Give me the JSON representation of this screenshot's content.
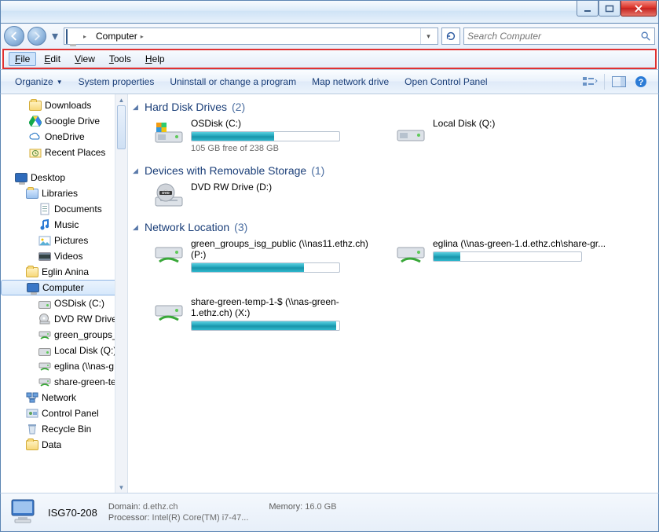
{
  "titlebar": {},
  "nav": {
    "breadcrumb_root_icon": "computer-icon",
    "breadcrumb_1": "Computer",
    "search_placeholder": "Search Computer"
  },
  "menubar": {
    "file": "File",
    "file_u": "F",
    "edit": "Edit",
    "edit_u": "E",
    "view": "View",
    "view_u": "V",
    "tools": "Tools",
    "tools_u": "T",
    "help": "Help",
    "help_u": "H"
  },
  "cmdbar": {
    "organize": "Organize",
    "sysprops": "System properties",
    "uninstall": "Uninstall or change a program",
    "mapdrive": "Map network drive",
    "controlpanel": "Open Control Panel"
  },
  "tree": {
    "quick": [
      {
        "name": "Downloads",
        "icon": "folder"
      },
      {
        "name": "Google Drive",
        "icon": "gdrive"
      },
      {
        "name": "OneDrive",
        "icon": "onedrive"
      },
      {
        "name": "Recent Places",
        "icon": "recent"
      }
    ],
    "desktop": "Desktop",
    "libraries": "Libraries",
    "lib_items": [
      {
        "name": "Documents",
        "icon": "doc"
      },
      {
        "name": "Music",
        "icon": "music"
      },
      {
        "name": "Pictures",
        "icon": "pic"
      },
      {
        "name": "Videos",
        "icon": "vid"
      }
    ],
    "user": "Eglin  Anina",
    "computer": "Computer",
    "drives": [
      {
        "name": "OSDisk (C:)",
        "icon": "osdrive"
      },
      {
        "name": "DVD RW Drive (",
        "icon": "dvd"
      },
      {
        "name": "green_groups_i",
        "icon": "netdrive"
      },
      {
        "name": "Local Disk (Q:)",
        "icon": "drive"
      },
      {
        "name": "eglina (\\\\nas-g",
        "icon": "netdrive"
      },
      {
        "name": "share-green-te",
        "icon": "netdrive"
      }
    ],
    "network": "Network",
    "cpanel": "Control Panel",
    "recycle": "Recycle Bin",
    "data": "Data"
  },
  "sections": {
    "hdd": {
      "title": "Hard Disk Drives",
      "count": "(2)"
    },
    "removable": {
      "title": "Devices with Removable Storage",
      "count": "(1)"
    },
    "netloc": {
      "title": "Network Location",
      "count": "(3)"
    }
  },
  "drives": {
    "osdisk": {
      "name": "OSDisk (C:)",
      "free": "105 GB free of 238 GB",
      "fill_pct": 56
    },
    "localq": {
      "name": "Local Disk (Q:)"
    },
    "dvd": {
      "name": "DVD RW Drive (D:)"
    },
    "p": {
      "name": "green_groups_isg_public (\\\\nas11.ethz.ch) (P:)",
      "fill_pct": 76
    },
    "eglina": {
      "name": "eglina (\\\\nas-green-1.d.ethz.ch\\share-gr...",
      "fill_pct": 18
    },
    "x": {
      "name": "share-green-temp-1-$ (\\\\nas-green-1.ethz.ch) (X:)",
      "fill_pct": 98
    }
  },
  "details": {
    "name": "ISG70-208",
    "domain_label": "Domain:",
    "domain": "d.ethz.ch",
    "processor_label": "Processor:",
    "processor": "Intel(R) Core(TM) i7-47...",
    "memory_label": "Memory:",
    "memory": "16.0 GB"
  }
}
